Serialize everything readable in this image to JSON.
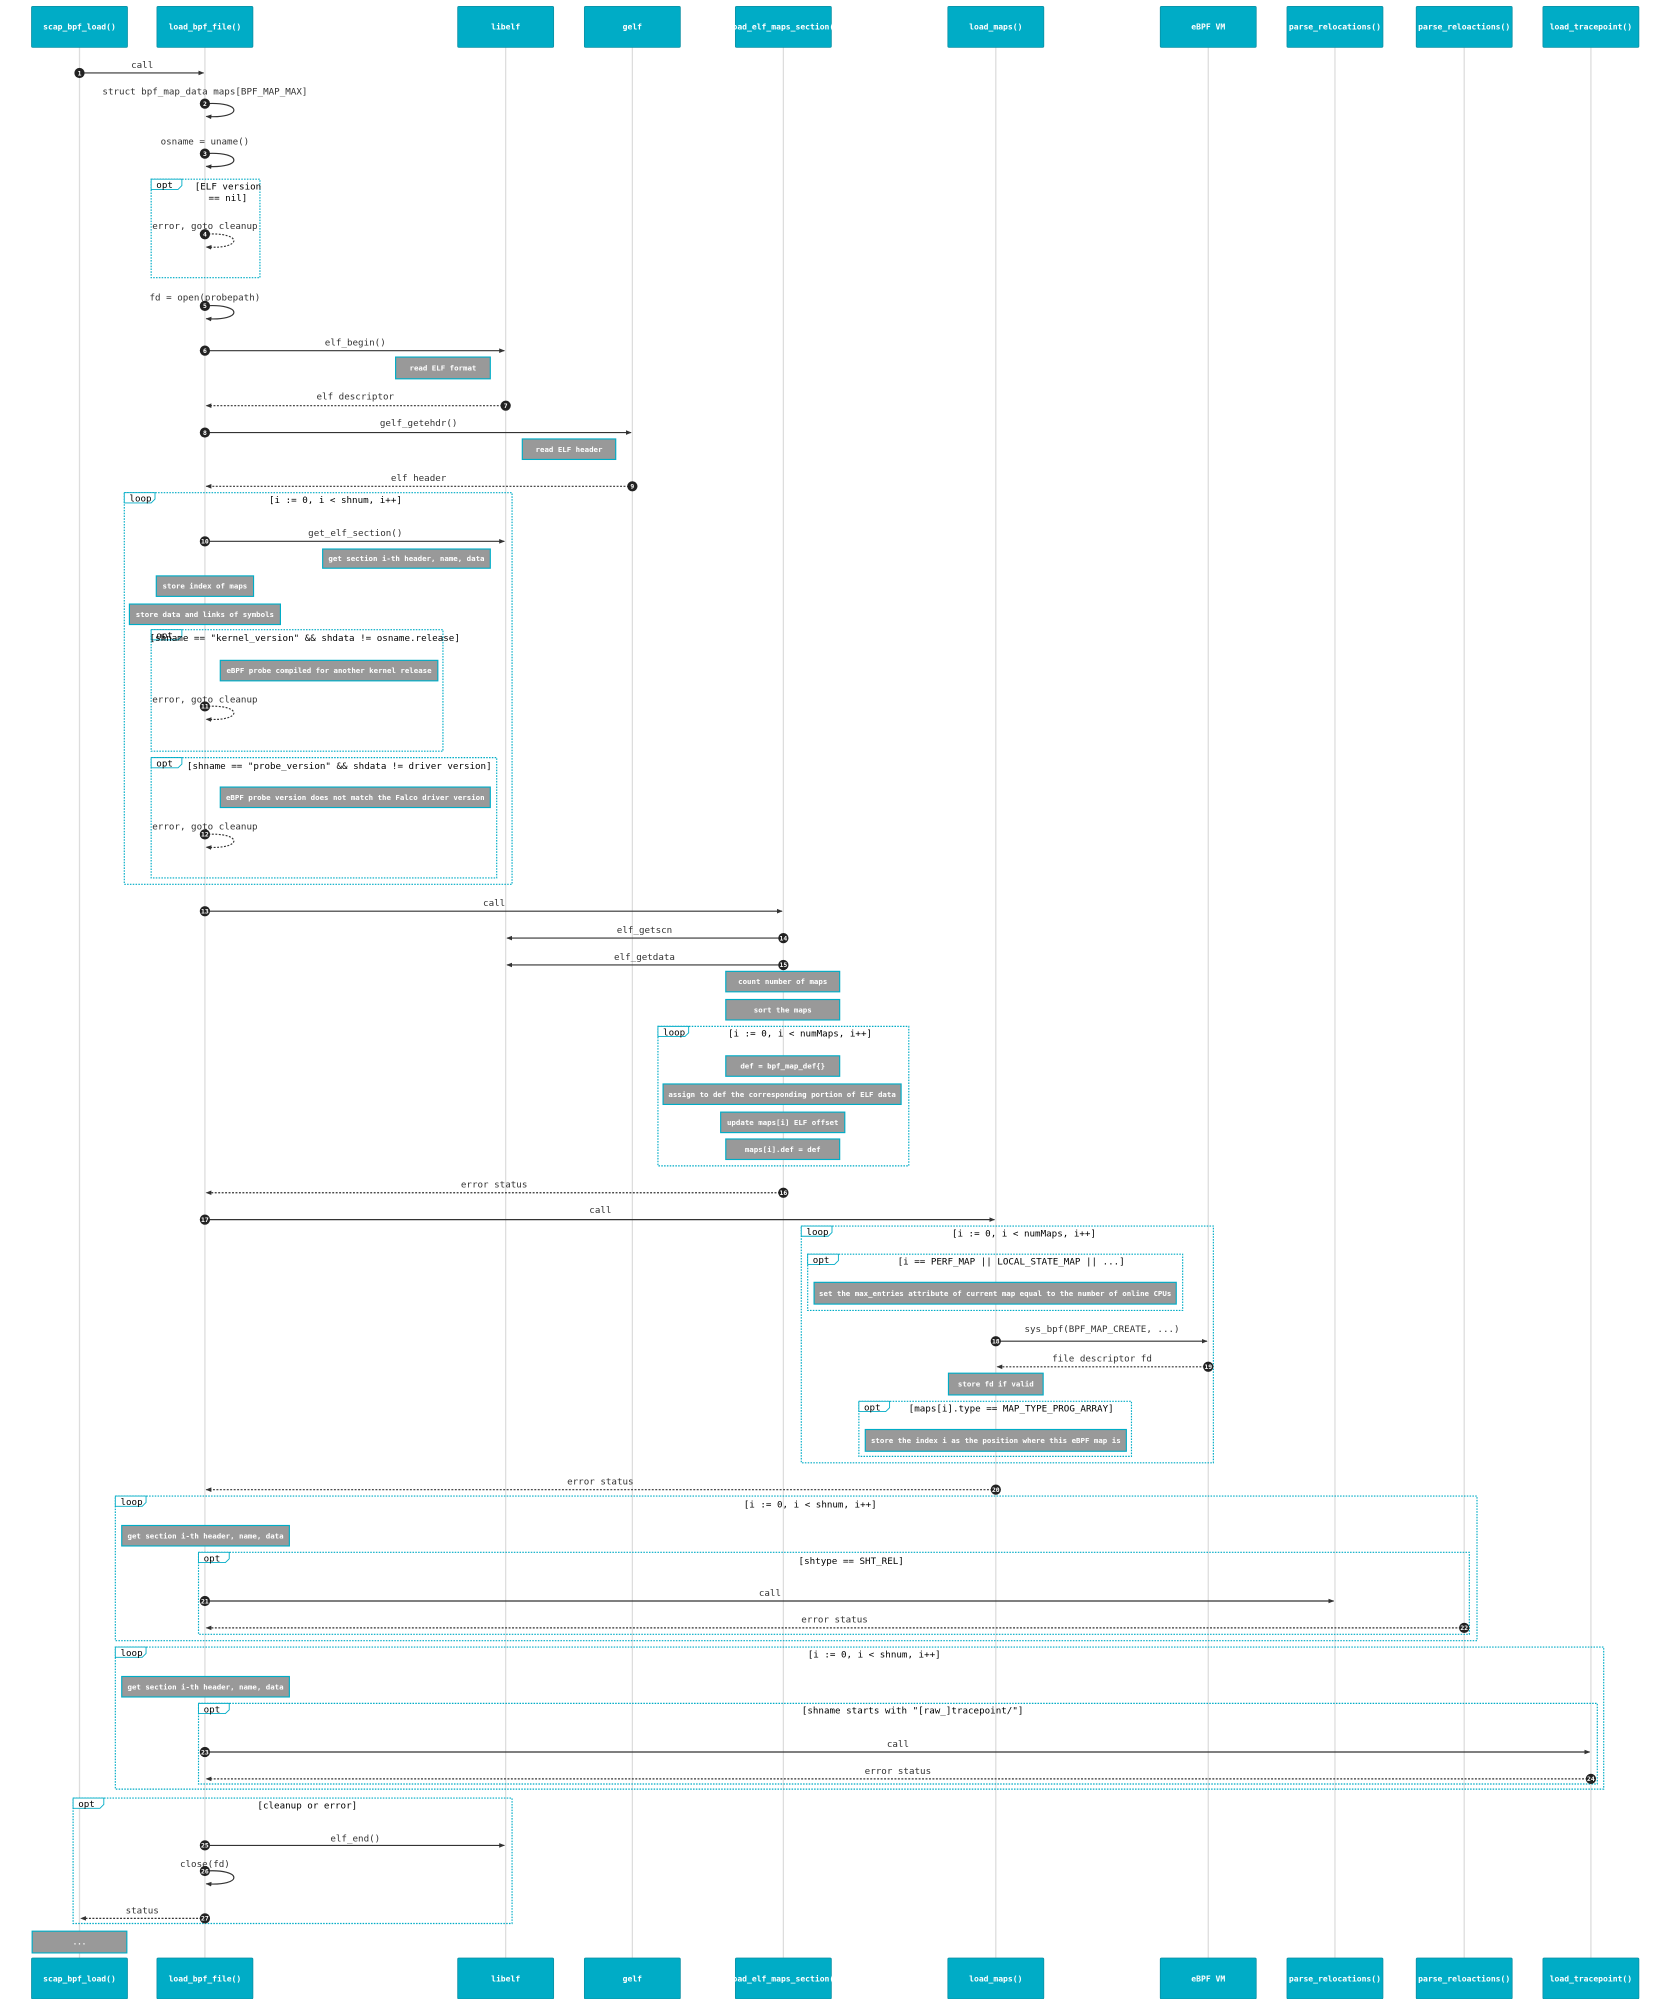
{
  "colors": {
    "participant": "#00acc6",
    "note_fill": "#999999",
    "note_border": "#00acc6",
    "frame": "#00acc6",
    "arrow": "#333333"
  },
  "participants": [
    "scap_bpf_load()",
    "load_bpf_file()",
    "libelf",
    "gelf",
    "load_elf_maps_section()",
    "load_maps()",
    "eBPF VM",
    "parse_relocations()",
    "parse_reloactions()",
    "load_tracepoint()"
  ],
  "messages": [
    {
      "n": "1",
      "label": "call"
    },
    {
      "n": "2",
      "label": "struct bpf_map_data maps[BPF_MAP_MAX]"
    },
    {
      "n": "3",
      "label": "osname = uname()"
    },
    {
      "n": "4",
      "label": "error, goto cleanup"
    },
    {
      "n": "5",
      "label": "fd = open(probepath)"
    },
    {
      "n": "6",
      "label": "elf_begin()"
    },
    {
      "n": "7",
      "label": "elf descriptor"
    },
    {
      "n": "8",
      "label": "gelf_getehdr()"
    },
    {
      "n": "9",
      "label": "elf header"
    },
    {
      "n": "10",
      "label": "get_elf_section()"
    },
    {
      "n": "11",
      "label": "error, goto cleanup"
    },
    {
      "n": "12",
      "label": "error, goto cleanup"
    },
    {
      "n": "13",
      "label": "call"
    },
    {
      "n": "14",
      "label": "elf_getscn"
    },
    {
      "n": "15",
      "label": "elf_getdata"
    },
    {
      "n": "16",
      "label": "error status"
    },
    {
      "n": "17",
      "label": "call"
    },
    {
      "n": "18",
      "label": "sys_bpf(BPF_MAP_CREATE, ...)"
    },
    {
      "n": "19",
      "label": "file descriptor fd"
    },
    {
      "n": "20",
      "label": "error status"
    },
    {
      "n": "21",
      "label": "call"
    },
    {
      "n": "22",
      "label": "error status"
    },
    {
      "n": "23",
      "label": "call"
    },
    {
      "n": "24",
      "label": "error status"
    },
    {
      "n": "25",
      "label": "elf_end()"
    },
    {
      "n": "26",
      "label": "close(fd)"
    },
    {
      "n": "27",
      "label": "status"
    }
  ],
  "notes": [
    "read ELF format",
    "read ELF header",
    "get section i-th header, name, data",
    "store index of maps",
    "store data and links of symbols",
    "eBPF probe compiled for another kernel release",
    "eBPF probe version does not match the Falco driver version",
    "count number of maps",
    "sort the maps",
    "def = bpf_map_def{}",
    "assign to def the corresponding portion of ELF data",
    "update maps[i] ELF offset",
    "maps[i].def = def",
    "set the max_entries attribute of current map equal to the number of online CPUs",
    "store fd if valid",
    "store the index i as the position where this eBPF map is",
    "get section i-th header, name, data",
    "get section i-th header, name, data",
    "..."
  ],
  "fragments": [
    {
      "kind": "opt",
      "cond": [
        "[ELF version",
        "== nil]"
      ]
    },
    {
      "kind": "loop",
      "cond": [
        "[i := 0, i < shnum, i++]"
      ]
    },
    {
      "kind": "opt",
      "cond": [
        "[shname == \"kernel_version\" && shdata != osname.release]"
      ]
    },
    {
      "kind": "opt",
      "cond": [
        "[shname == \"probe_version\" && shdata != driver version]"
      ]
    },
    {
      "kind": "loop",
      "cond": [
        "[i := 0, i < numMaps, i++]"
      ]
    },
    {
      "kind": "loop",
      "cond": [
        "[i := 0, i < numMaps, i++]"
      ]
    },
    {
      "kind": "opt",
      "cond": [
        "[i == PERF_MAP || LOCAL_STATE_MAP || ...]"
      ]
    },
    {
      "kind": "opt",
      "cond": [
        "[maps[i].type == MAP_TYPE_PROG_ARRAY]"
      ]
    },
    {
      "kind": "loop",
      "cond": [
        "[i := 0, i < shnum, i++]"
      ]
    },
    {
      "kind": "opt",
      "cond": [
        "[shtype == SHT_REL]"
      ]
    },
    {
      "kind": "loop",
      "cond": [
        "[i := 0, i < shnum, i++]"
      ]
    },
    {
      "kind": "opt",
      "cond": [
        "[shname starts with \"[raw_]tracepoint/\"]"
      ]
    },
    {
      "kind": "opt",
      "cond": [
        "[cleanup or error]"
      ]
    }
  ]
}
